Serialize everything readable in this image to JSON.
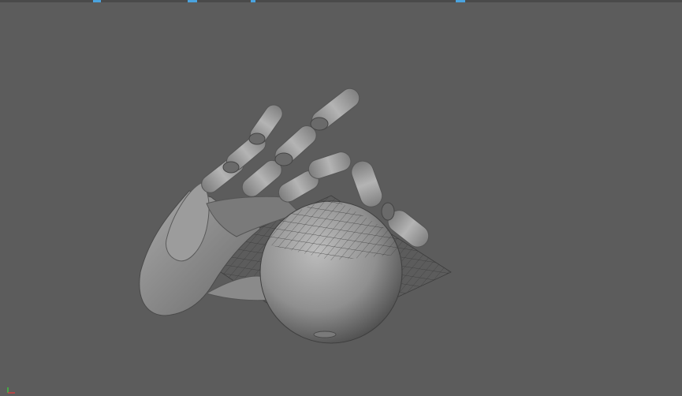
{
  "viewport": {
    "background": "#5c5c5c",
    "accent": "#4aa3df",
    "objects": [
      "robot-hand-model",
      "sphere-model",
      "grid-plane"
    ]
  },
  "axis": {
    "x_color": "#d04040",
    "y_color": "#40c040"
  }
}
